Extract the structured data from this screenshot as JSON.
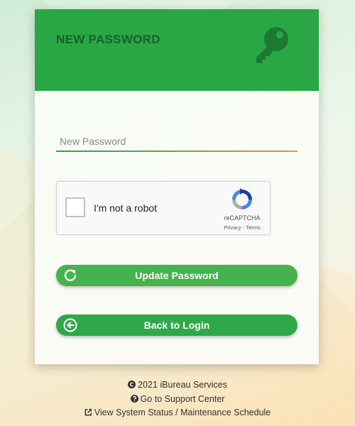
{
  "card": {
    "title": "NEW PASSWORD"
  },
  "form": {
    "password_placeholder": "New Password",
    "password_value": ""
  },
  "captcha": {
    "label": "I'm not a robot",
    "brand": "reCAPTCHA",
    "links": "Privacy - Terms",
    "checked": false
  },
  "buttons": {
    "update_label": "Update Password",
    "back_label": "Back to Login"
  },
  "footer": {
    "copyright": "2021 iBureau Services",
    "support": "Go to Support Center",
    "status": "View System Status / Maintenance Schedule"
  },
  "colors": {
    "primary_green": "#29a745",
    "header_title": "#1d5e2a",
    "underline_end": "#e0a020"
  },
  "icons": {
    "header": "key-icon",
    "update": "refresh-icon",
    "back": "arrow-left-circle-icon",
    "copyright": "copyright-icon",
    "support": "question-circle-icon",
    "status": "external-link-icon"
  }
}
